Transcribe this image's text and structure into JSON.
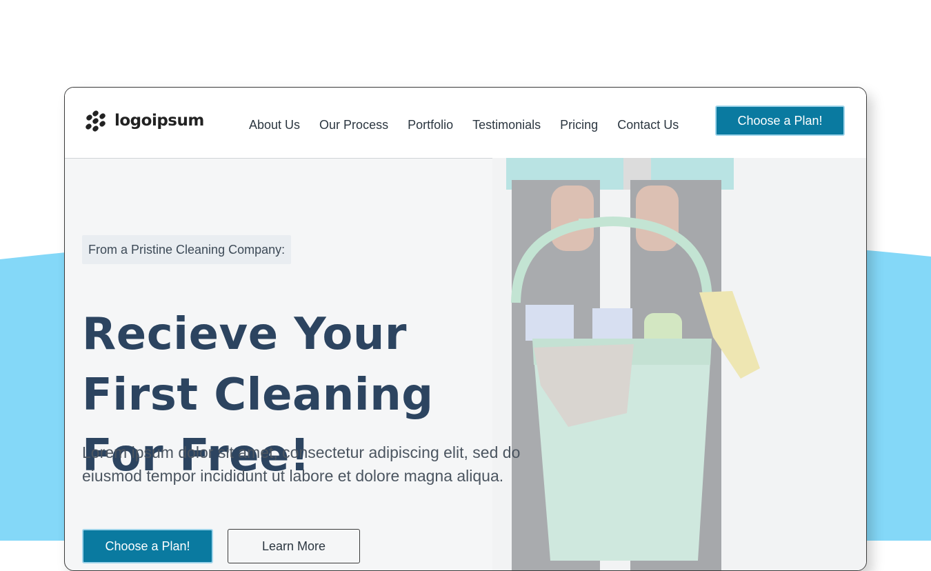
{
  "brand": {
    "name": "logoipsum"
  },
  "nav": {
    "items": [
      "About Us",
      "Our Process",
      "Portfolio",
      "Testimonials",
      "Pricing",
      "Contact Us"
    ],
    "cta_label": "Choose a Plan!"
  },
  "hero": {
    "eyebrow": "From a Pristine Cleaning Company:",
    "title": "Recieve Your First Cleaning For Free!",
    "body": "Lorem ipsum dolor sit amet, consectetur adipiscing elit, sed do eiusmod tempor incididunt ut labore et dolore magna aliqua.",
    "primary_button": "Choose a Plan!",
    "secondary_button": "Learn More"
  },
  "colors": {
    "accent": "#0a7aa0",
    "headline": "#2c4460",
    "background_wave": "#84d8f8"
  }
}
